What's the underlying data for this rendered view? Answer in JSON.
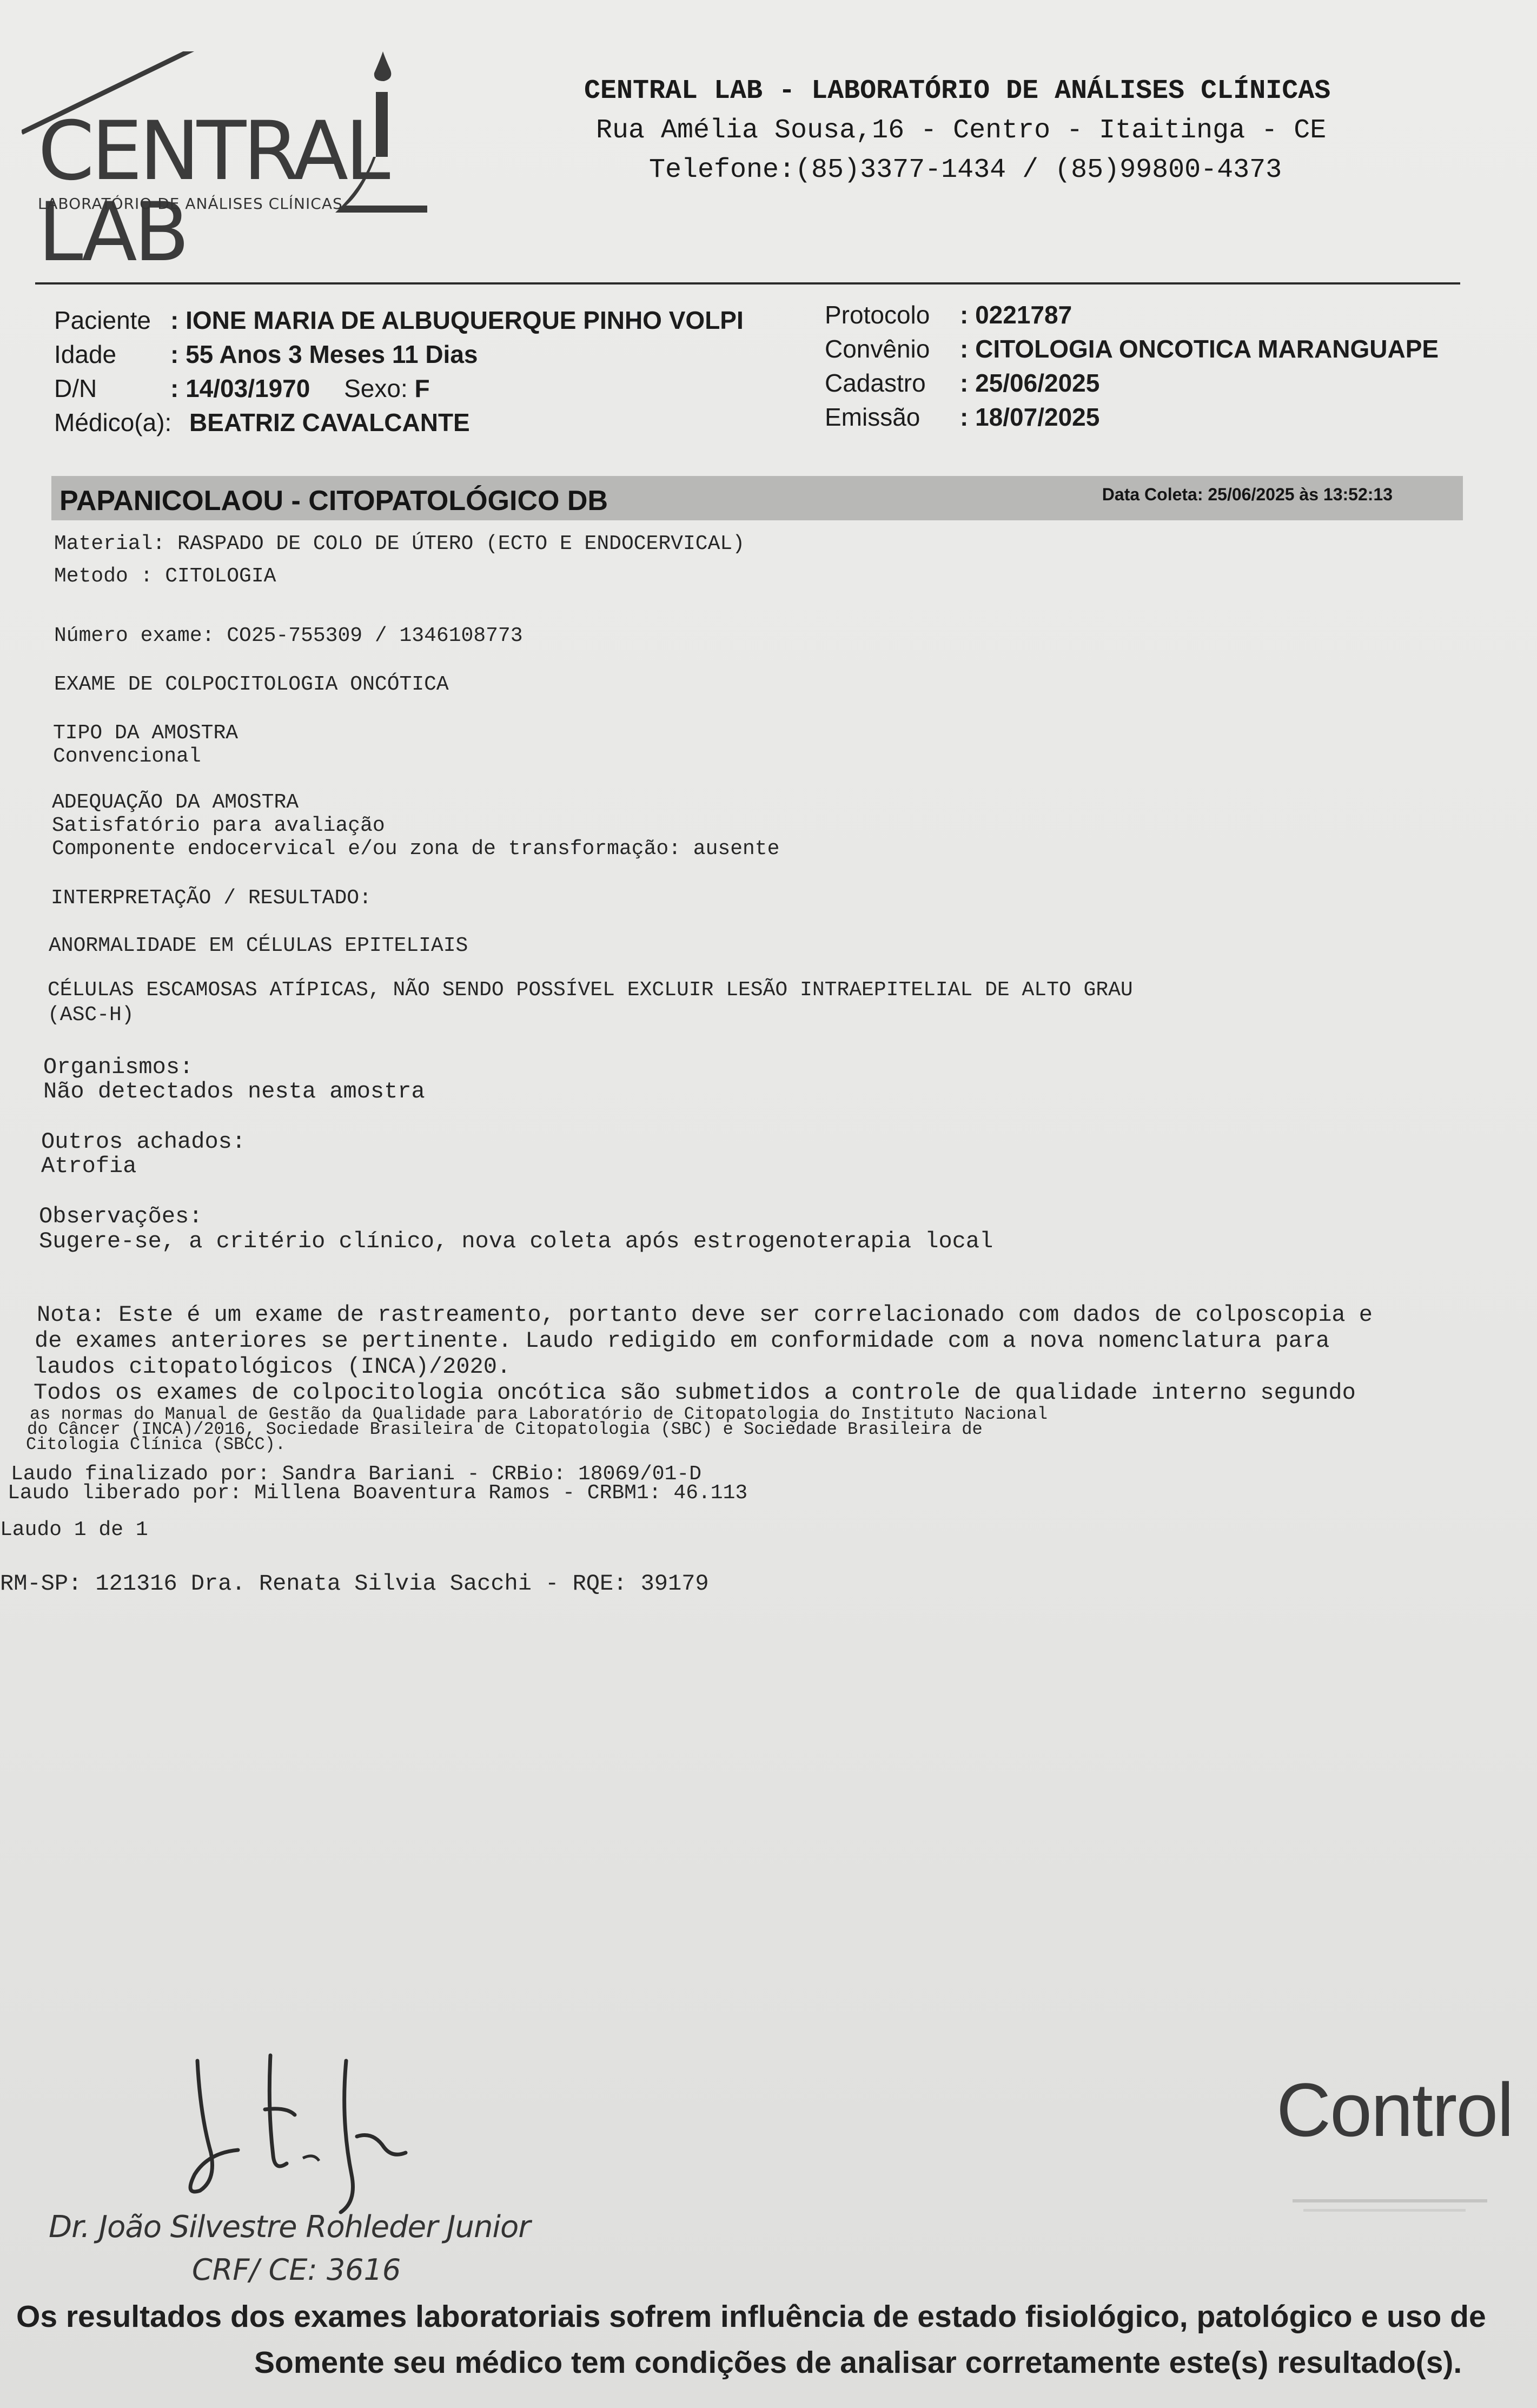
{
  "header": {
    "logo_text": "CENTRAL LAB",
    "logo_sub": "LABORATÓRIO DE ANÁLISES CLÍNICAS",
    "lab_name": "CENTRAL LAB - LABORATÓRIO DE ANÁLISES CLÍNICAS",
    "address": "Rua Amélia Sousa,16 - Centro - Itaitinga - CE",
    "phone": "Telefone:(85)3377-1434 / (85)99800-4373"
  },
  "patient": {
    "paciente_label": "Paciente",
    "paciente": ": IONE MARIA DE ALBUQUERQUE PINHO VOLPI",
    "idade_label": "Idade",
    "idade": ": 55 Anos 3 Meses 11 Dias",
    "dn_label": "D/N",
    "dn": ": 14/03/1970",
    "sexo_label": "Sexo:",
    "sexo": "F",
    "medico_label": "Médico(a):",
    "medico": "BEATRIZ CAVALCANTE",
    "protocolo_label": "Protocolo",
    "protocolo": ": 0221787",
    "convenio_label": "Convênio",
    "convenio": ": CITOLOGIA ONCOTICA MARANGUAPE",
    "cadastro_label": "Cadastro",
    "cadastro": ": 25/06/2025",
    "emissao_label": "Emissão",
    "emissao": ": 18/07/2025"
  },
  "exam": {
    "title": "PAPANICOLAOU - CITOPATOLÓGICO DB",
    "data_coleta": "Data Coleta: 25/06/2025 às 13:52:13",
    "material": "Material: RASPADO DE COLO DE ÚTERO (ECTO E ENDOCERVICAL)",
    "metodo": "Metodo : CITOLOGIA",
    "numero": "Número exame: CO25-755309 / 1346108773",
    "exame_nome": "EXAME DE COLPOCITOLOGIA ONCÓTICA",
    "tipo_label": "TIPO DA AMOSTRA",
    "tipo": "Convencional",
    "adequacao_label": "ADEQUAÇÃO DA AMOSTRA",
    "adequacao1": "Satisfatório para avaliação",
    "adequacao2": "Componente endocervical e/ou zona de transformação: ausente",
    "interpretacao_label": "INTERPRETAÇÃO / RESULTADO:",
    "anormalidade": "ANORMALIDADE EM CÉLULAS EPITELIAIS",
    "celulas1": "CÉLULAS ESCAMOSAS ATÍPICAS, NÃO SENDO POSSÍVEL EXCLUIR LESÃO INTRAEPITELIAL DE ALTO GRAU",
    "celulas2": "(ASC-H)",
    "organismos_label": "Organismos:",
    "organismos": "Não detectados nesta amostra",
    "outros_label": "Outros achados:",
    "outros": "Atrofia",
    "observacoes_label": "Observações:",
    "observacoes": "Sugere-se, a critério clínico, nova coleta após estrogenoterapia local",
    "nota1": "Nota: Este é um exame de rastreamento, portanto deve ser correlacionado com dados de colposcopia e",
    "nota2": "de exames anteriores se pertinente. Laudo redigido em conformidade com a nova nomenclatura para",
    "nota3": "laudos citopatológicos (INCA)/2020.",
    "nota4": "Todos os exames de colpocitologia oncótica são submetidos a controle de qualidade interno segundo",
    "nota5": "as normas do Manual de Gestão da Qualidade para Laboratório de Citopatologia do Instituto Nacional",
    "nota6": "do Câncer (INCA)/2016, Sociedade Brasileira de Citopatologia (SBC) e Sociedade Brasileira de",
    "nota7": "Citologia Clínica (SBCC).",
    "finalizado": "Laudo finalizado por: Sandra Bariani - CRBio: 18069/01-D",
    "liberado": "Laudo liberado por: Millena Boaventura Ramos - CRBM1: 46.113",
    "laudo_pagina": "Laudo 1 de 1",
    "crm": "RM-SP: 121316 Dra. Renata Silvia Sacchi - RQE: 39179"
  },
  "footer": {
    "signature_name": "Dr. João Silvestre Rohleder Junior",
    "signature_crf": "CRF/ CE: 3616",
    "control_logo": "Control",
    "disclaimer1": "Os resultados dos exames laboratoriais sofrem influência de estado fisiológico, patológico e uso de",
    "disclaimer2": "Somente seu médico tem condições de analisar corretamente este(s) resultado(s)."
  }
}
